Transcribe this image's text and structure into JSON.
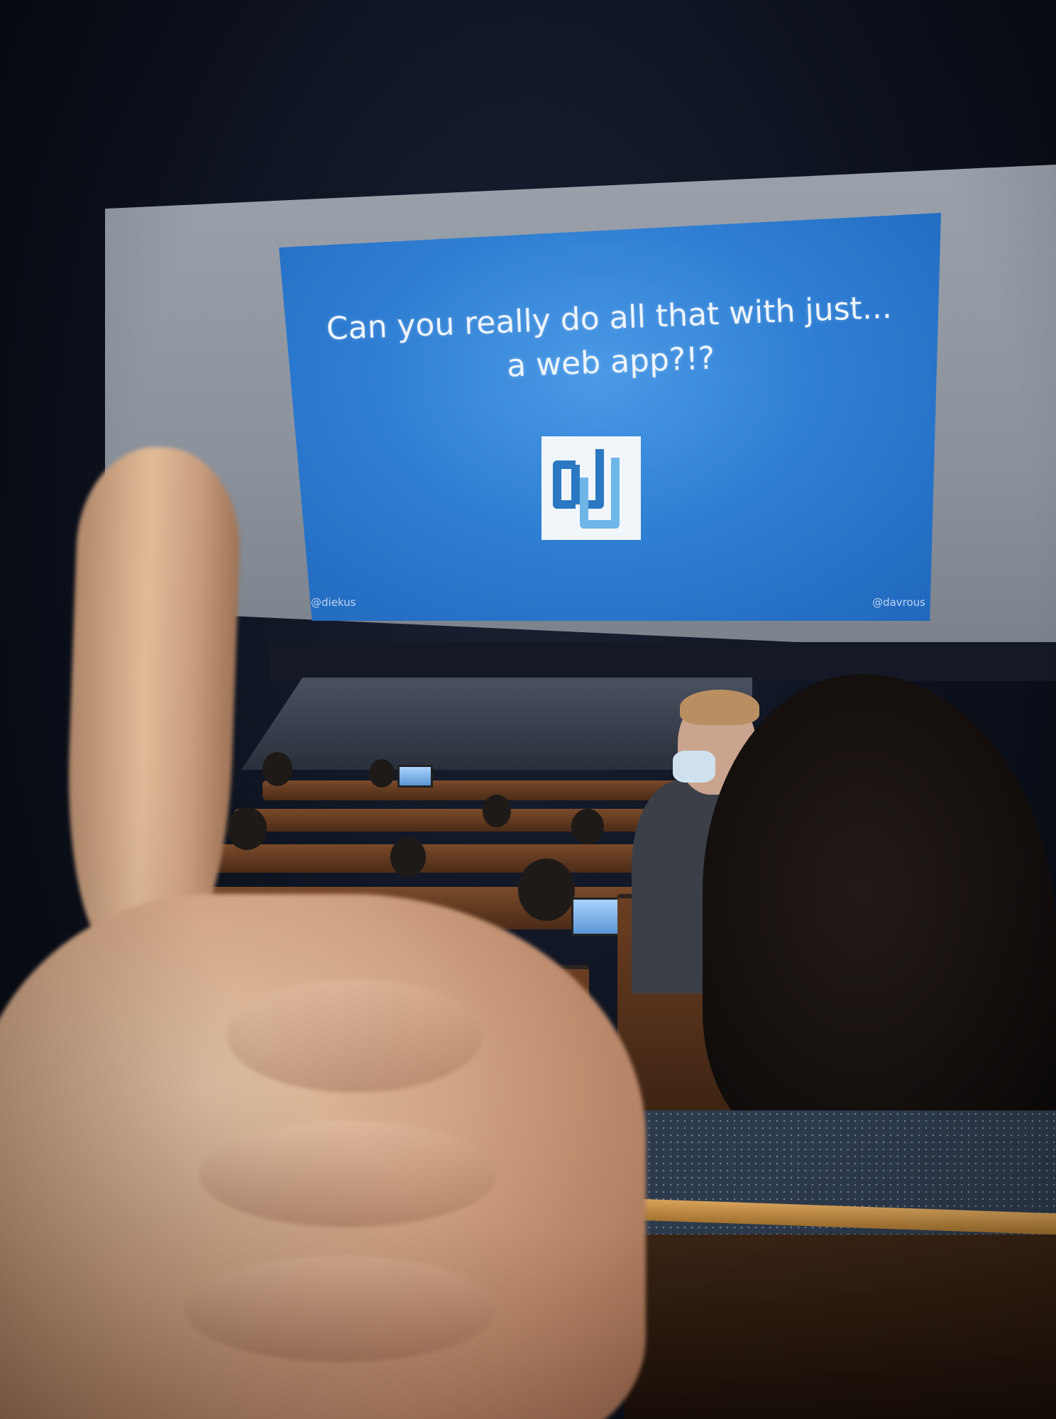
{
  "slide": {
    "title": "Can you really do all that with just...\na web app?!?",
    "handle_left": "@diekus",
    "handle_right": "@davrous"
  },
  "colors": {
    "slide_blue": "#2f7fd4",
    "logo_outline_dark": "#2b78c2",
    "logo_outline_light": "#6fb6e8",
    "logo_background": "#f1f6fb"
  }
}
